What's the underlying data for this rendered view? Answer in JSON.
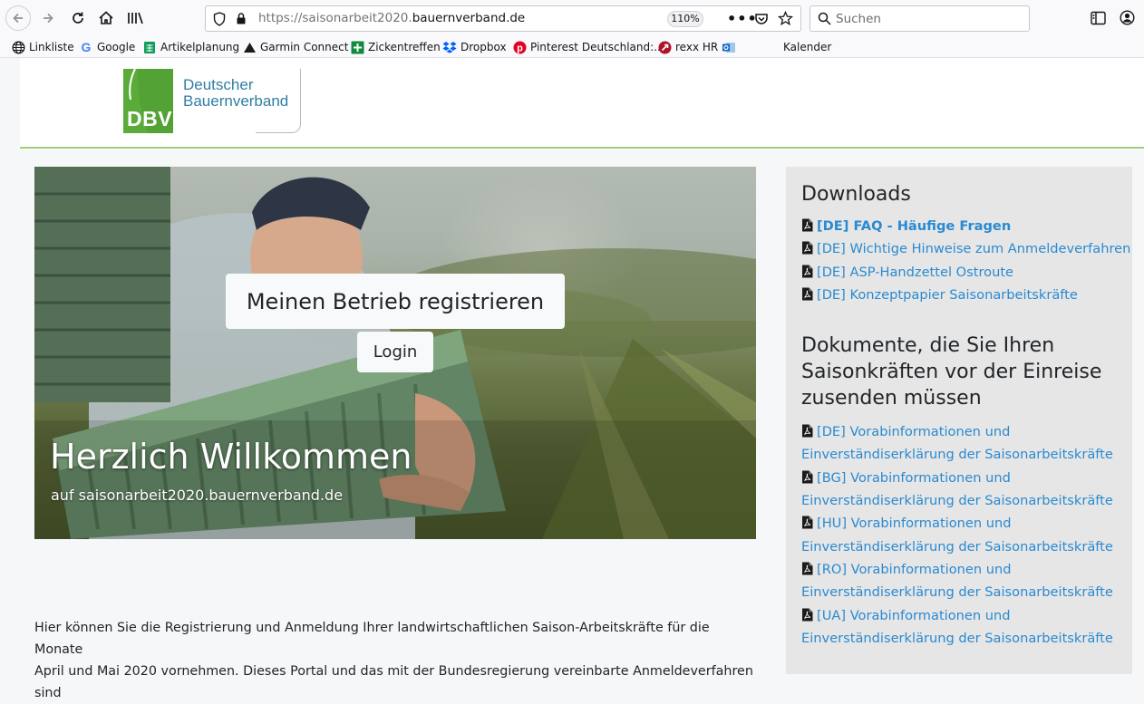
{
  "browser": {
    "url_prefix": "https://saisonarbeit2020.",
    "url_domain": "bauernverband.de",
    "zoom": "110%",
    "search_placeholder": "Suchen",
    "bookmarks": [
      {
        "label": "Linkliste",
        "icon": "globe-icon"
      },
      {
        "label": "Google",
        "icon": "google-icon"
      },
      {
        "label": "Artikelplanung",
        "icon": "sheets-icon"
      },
      {
        "label": "Garmin Connect",
        "icon": "garmin-icon"
      },
      {
        "label": "Zickentreffen",
        "icon": "plus-icon"
      },
      {
        "label": "Dropbox",
        "icon": "dropbox-icon"
      },
      {
        "label": "Pinterest Deutschland:...",
        "icon": "pinterest-icon"
      },
      {
        "label": "rexx HR",
        "icon": "rexx-icon"
      },
      {
        "label": "",
        "icon": "outlook-icon"
      },
      {
        "label": "Kalender",
        "icon": ""
      }
    ]
  },
  "header": {
    "logo_mark": "DBV",
    "logo_line1": "Deutscher",
    "logo_line2": "Bauernverband"
  },
  "hero": {
    "register_button": "Meinen Betrieb registrieren",
    "login_button": "Login",
    "title": "Herzlich Willkommen",
    "subtitle": "auf saisonarbeit2020.bauernverband.de"
  },
  "intro": {
    "line1": "Hier können Sie die Registrierung und Anmeldung Ihrer landwirtschaftlichen Saison-Arbeitskräfte für die Monate",
    "line2": "April und Mai 2020 vornehmen. Dieses Portal und das mit der Bundesregierung vereinbarte Anmeldeverfahren sind"
  },
  "sidebar": {
    "downloads_title": "Downloads",
    "downloads": [
      "[DE] FAQ - Häufige Fragen",
      "[DE] Wichtige Hinweise zum Anmeldeverfahren",
      "[DE] ASP-Handzettel Ostroute",
      "[DE] Konzeptpapier Saisonarbeitskräfte"
    ],
    "documents_title_l1": "Dokumente, die Sie Ihren",
    "documents_title_l2": "Saisonkräften vor der Einreise",
    "documents_title_l3": "zusenden müssen",
    "documents": [
      {
        "line1": "[DE] Vorabinformationen und",
        "line2": "Einverständiserklärung der Saisonarbeitskräfte"
      },
      {
        "line1": "[BG] Vorabinformationen und",
        "line2": "Einverständiserklärung der Saisonarbeitskräfte"
      },
      {
        "line1": "[HU] Vorabinformationen und",
        "line2": "Einverständiserklärung der Saisonarbeitskräfte"
      },
      {
        "line1": "[RO] Vorabinformationen und",
        "line2": "Einverständiserklärung der Saisonarbeitskräfte"
      },
      {
        "line1": "[UA] Vorabinformationen und",
        "line2": "Einverständiserklärung der Saisonarbeitskräfte"
      }
    ]
  },
  "colors": {
    "link": "#2a8ad1",
    "brand_green": "#5aab3a",
    "brand_blue": "#2f7fa2",
    "header_rule": "#a3cd7a",
    "sidebar_bg": "#e6e6e6"
  }
}
